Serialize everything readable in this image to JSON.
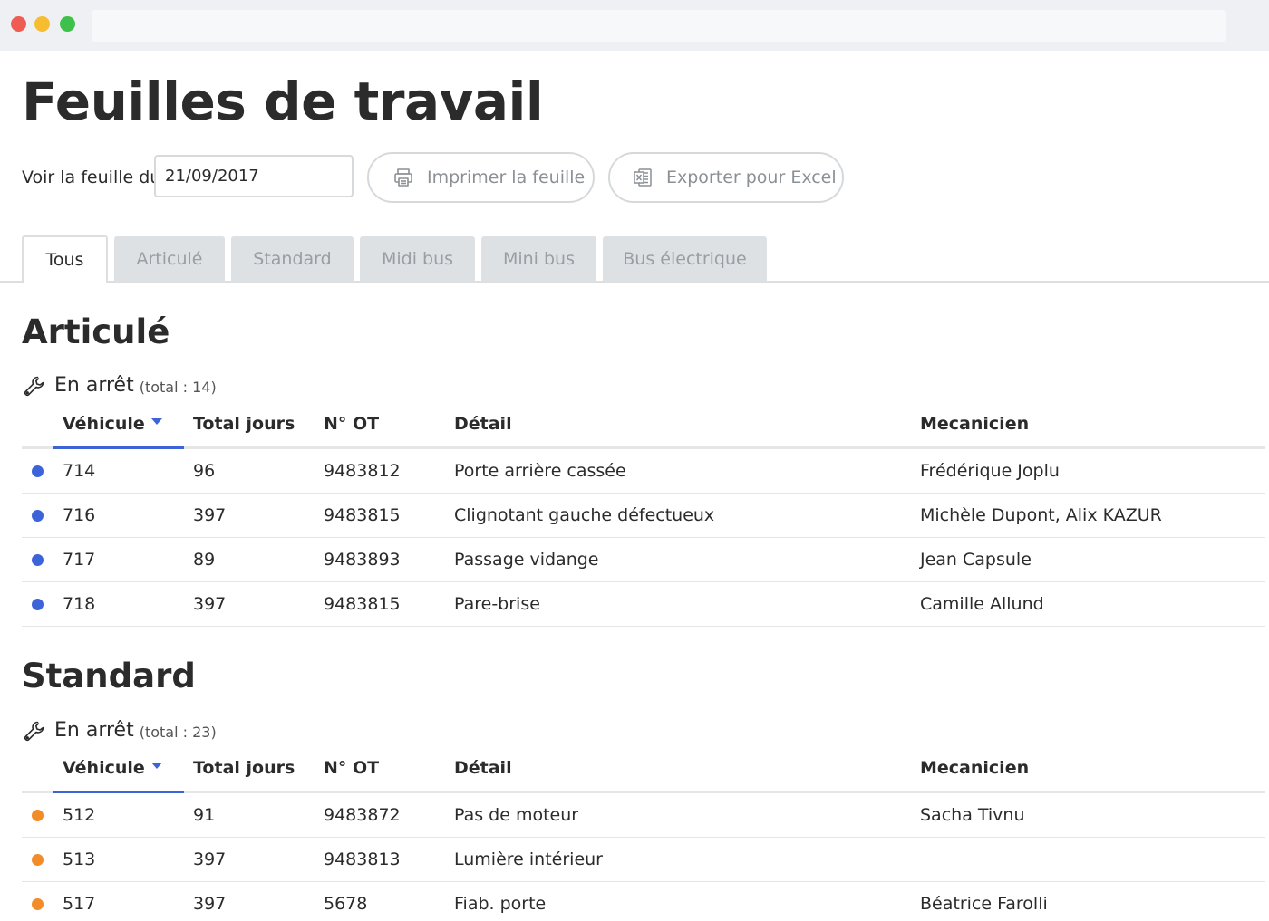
{
  "page": {
    "title": "Feuilles de travail"
  },
  "toolbar": {
    "date_label": "Voir la feuille du",
    "date_value": "21/09/2017",
    "print_label": "Imprimer la feuille",
    "export_label": "Exporter pour Excel",
    "print_icon": "printer-icon",
    "export_icon": "excel-icon"
  },
  "tabs": [
    {
      "label": "Tous",
      "active": true
    },
    {
      "label": "Articulé",
      "active": false
    },
    {
      "label": "Standard",
      "active": false
    },
    {
      "label": "Midi bus",
      "active": false
    },
    {
      "label": "Mini bus",
      "active": false
    },
    {
      "label": "Bus électrique",
      "active": false
    }
  ],
  "columns": {
    "vehicle": "Véhicule",
    "days": "Total jours",
    "ot": "N° OT",
    "detail": "Détail",
    "mechanic": "Mecanicien"
  },
  "sections": [
    {
      "title": "Articulé",
      "status_label": "En arrêt",
      "total_text": "(total : 14)",
      "dot_color": "#3d63d8",
      "rows": [
        {
          "vehicle": "714",
          "days": "96",
          "ot": "9483812",
          "detail": "Porte arrière cassée",
          "mechanic": "Frédérique Joplu"
        },
        {
          "vehicle": "716",
          "days": "397",
          "ot": "9483815",
          "detail": "Clignotant gauche défectueux",
          "mechanic": "Michèle Dupont, Alix KAZUR"
        },
        {
          "vehicle": "717",
          "days": "89",
          "ot": "9483893",
          "detail": "Passage vidange",
          "mechanic": "Jean Capsule"
        },
        {
          "vehicle": "718",
          "days": "397",
          "ot": "9483815",
          "detail": "Pare-brise",
          "mechanic": "Camille Allund"
        }
      ]
    },
    {
      "title": "Standard",
      "status_label": "En arrêt",
      "total_text": "(total : 23)",
      "dot_color": "#f28c28",
      "rows": [
        {
          "vehicle": "512",
          "days": "91",
          "ot": "9483872",
          "detail": "Pas de moteur",
          "mechanic": "Sacha Tivnu"
        },
        {
          "vehicle": "513",
          "days": "397",
          "ot": "9483813",
          "detail": "Lumière intérieur",
          "mechanic": ""
        },
        {
          "vehicle": "517",
          "days": "397",
          "ot": "5678",
          "detail": "Fiab. porte",
          "mechanic": "Béatrice Farolli"
        }
      ]
    }
  ],
  "colors": {
    "accent": "#3d63d8",
    "orange": "#f28c28"
  }
}
